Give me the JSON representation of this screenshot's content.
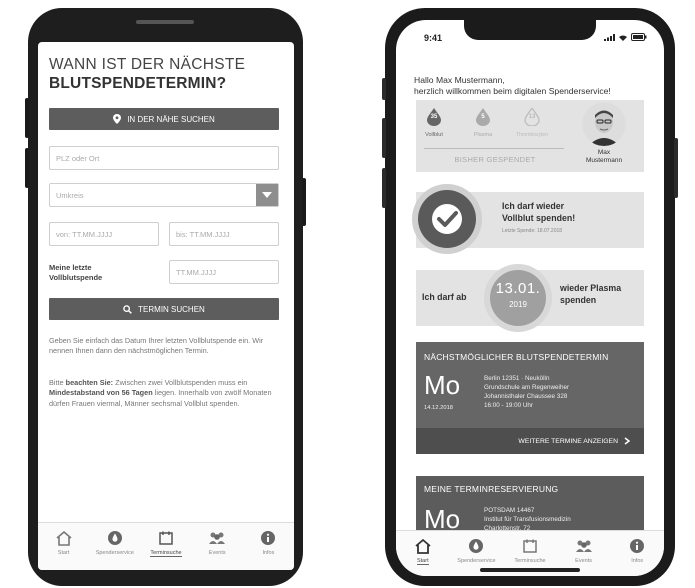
{
  "left_screen": {
    "title_line1": "WANN IST DER NÄCHSTE",
    "title_line2": "BLUTSPENDETERMIN?",
    "nearby_button": "IN DER NÄHE SUCHEN",
    "plz_placeholder": "PLZ oder Ort",
    "radius_placeholder": "Umkreis",
    "from_placeholder": "von: TT.MM.JJJJ",
    "to_placeholder": "bis: TT.MM.JJJJ",
    "last_donation_label": "Meine letzte Vollblutspende",
    "last_donation_placeholder": "TT.MM.JJJJ",
    "search_button": "TERMIN SUCHEN",
    "info_text": "Geben Sie einfach das Datum Ihrer letzten Vollblutspende ein. Wir nennen Ihnen dann den nächstmöglichen Termin.",
    "notice_prefix": "Bitte ",
    "notice_bold1": "beachten Sie:",
    "notice_mid": " Zwischen zwei Vollblutspenden muss ein ",
    "notice_bold2": "Mindestabstand von 56 Tagen",
    "notice_suffix": " liegen. Innerhalb von zwölf Monaten dürfen Frauen viermal, Männer sechsmal Vollblut spenden.",
    "tabs": [
      "Start",
      "Spenderservice",
      "Terminsuche",
      "Events",
      "Infos"
    ],
    "active_tab": "Terminsuche"
  },
  "right_screen": {
    "status_time": "9:41",
    "greeting_line1": "Hallo Max Mustermann,",
    "greeting_line2": "herzlich willkommen beim digitalen Spenderservice!",
    "donation_counts": [
      {
        "count": "35",
        "label": "Vollblut"
      },
      {
        "count": "5",
        "label": "Plasma"
      },
      {
        "count": "13",
        "label": "Thrombozyten"
      }
    ],
    "donated_so_far": "BISHER GESPENDET",
    "user_name_line1": "Max",
    "user_name_line2": "Mustermann",
    "status_title_line1": "Ich darf wieder",
    "status_title_line2": "Vollblut spenden!",
    "status_sub": "Letzte Spende: 18.07.2018",
    "plasma_prefix": "Ich darf ab",
    "plasma_date": "13.01.",
    "plasma_year": "2019",
    "plasma_suffix_line1": "wieder Plasma",
    "plasma_suffix_line2": "spenden",
    "next_header": "NÄCHSTMÖGLICHER BLUTSPENDETERMIN",
    "next_day": "Mo",
    "next_date": "14.12.2018",
    "next_location_line1": "Berlin 12351 · Neukölln",
    "next_location_line2": "Grundschule am Regenweiher",
    "next_location_line3": "Johannisthaler Chaussee 328",
    "next_time": "16:00 - 19:00 Uhr",
    "more_button": "WEITERE TERMINE ANZEIGEN",
    "reservation_header": "MEINE TERMINRESERVIERUNG",
    "res_day": "Mo",
    "res_line1": "POTSDAM 14467",
    "res_line2": "Institut für Transfusionsmedizin",
    "res_line3": "Charlottenstr. 72",
    "tabs": [
      "Start",
      "Spenderservice",
      "Terminsuche",
      "Events",
      "Infos"
    ],
    "active_tab": "Start"
  }
}
